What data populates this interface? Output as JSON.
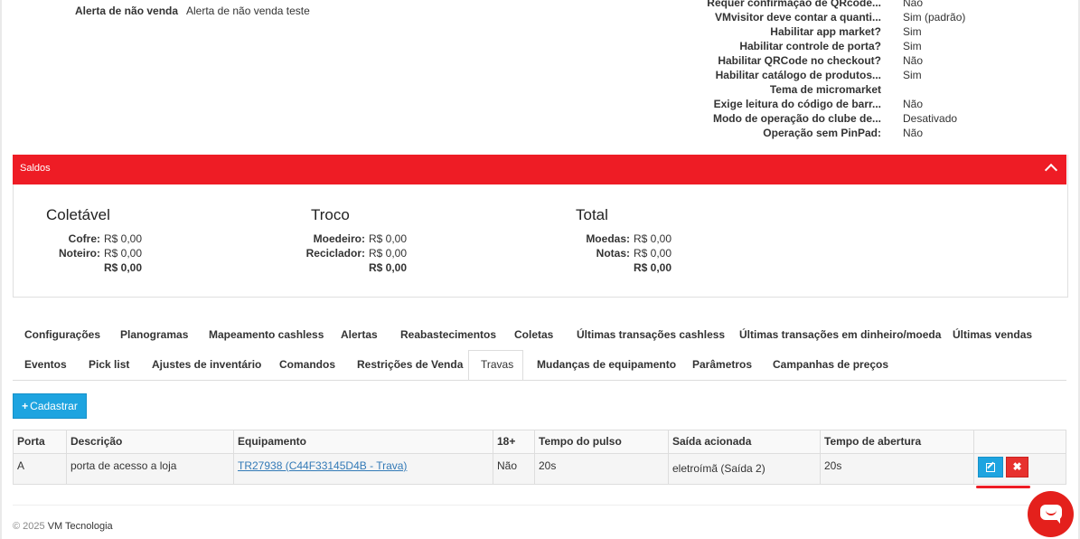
{
  "alert": {
    "label": "Alerta de não venda",
    "value": "Alerta de não venda teste"
  },
  "properties": [
    {
      "label": "Requer confirmação de QRcode...",
      "value": "Não"
    },
    {
      "label": "VMvisitor deve contar a quanti...",
      "value": "Sim (padrão)"
    },
    {
      "label": "Habilitar app market?",
      "value": "Sim"
    },
    {
      "label": "Habilitar controle de porta?",
      "value": "Sim"
    },
    {
      "label": "Habilitar QRCode no checkout?",
      "value": "Não"
    },
    {
      "label": "Habilitar catálogo de produtos...",
      "value": "Sim"
    },
    {
      "label": "Tema de micromarket",
      "value": ""
    },
    {
      "label": "Exige leitura do código de barr...",
      "value": "Não"
    },
    {
      "label": "Modo de operação do clube de...",
      "value": "Desativado"
    },
    {
      "label": "Operação sem PinPad:",
      "value": "Não"
    }
  ],
  "saldos": {
    "title": "Saldos",
    "coletavel": {
      "title": "Coletável",
      "cofre_label": "Cofre:",
      "cofre": "R$ 0,00",
      "noteiro_label": "Noteiro:",
      "noteiro": "R$ 0,00",
      "total": "R$ 0,00"
    },
    "troco": {
      "title": "Troco",
      "moedeiro_label": "Moedeiro:",
      "moedeiro": "R$ 0,00",
      "reciclador_label": "Reciclador:",
      "reciclador": "R$ 0,00",
      "total": "R$ 0,00"
    },
    "total": {
      "title": "Total",
      "moedas_label": "Moedas:",
      "moedas": "R$ 0,00",
      "notas_label": "Notas:",
      "notas": "R$ 0,00",
      "total": "R$ 0,00"
    }
  },
  "tabs_row1": [
    "Configurações",
    "Planogramas",
    "Mapeamento cashless",
    "Alertas",
    "Reabastecimentos",
    "Coletas",
    "Últimas transações cashless",
    "Últimas transações em dinheiro/moeda",
    "Últimas vendas"
  ],
  "tabs_row2": [
    "Eventos",
    "Pick list",
    "Ajustes de inventário",
    "Comandos",
    "Restrições de Venda",
    "Travas",
    "Mudanças de equipamento",
    "Parâmetros",
    "Campanhas de preços"
  ],
  "active_tab": "Travas",
  "add_button": "Cadastrar",
  "table": {
    "headers": [
      "Porta",
      "Descrição",
      "Equipamento",
      "18+",
      "Tempo do pulso",
      "Saída acionada",
      "Tempo de abertura"
    ],
    "rows": [
      {
        "porta": "A",
        "descricao": "porta de acesso a loja",
        "equipamento": "TR27938 (C44F33145D4B - Trava)",
        "maior18": "Não",
        "pulso": "20s",
        "saida": "eletroímã (Saída 2)",
        "abertura": "20s"
      }
    ]
  },
  "delete_glyph": "✖",
  "footer": {
    "copyright": "© 2025",
    "brand": "VM Tecnologia"
  },
  "colors": {
    "brand_red": "#ee1c25",
    "primary_blue": "#1ea4e0",
    "danger_red": "#e7312e"
  }
}
